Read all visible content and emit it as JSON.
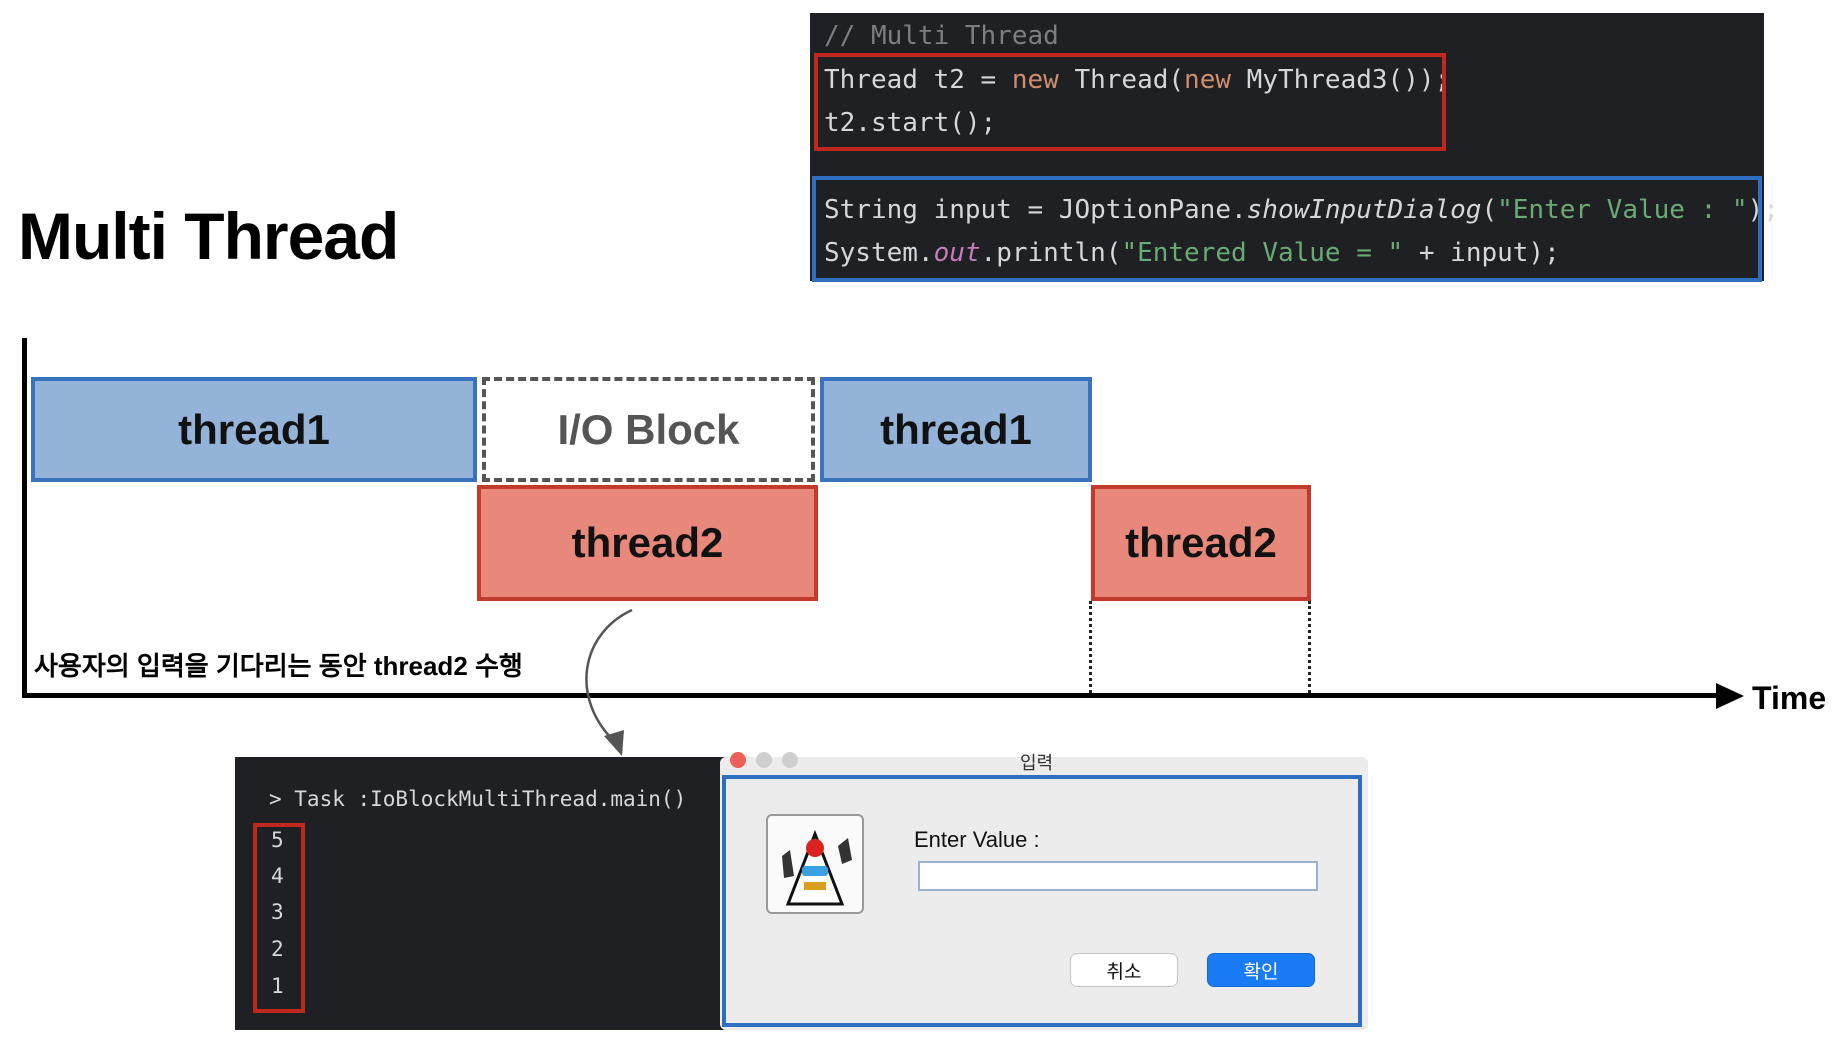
{
  "title": "Multi Thread",
  "code": {
    "comment": "// Multi Thread",
    "line1": {
      "a": "Thread t2 = ",
      "kw1": "new",
      "b": " Thread(",
      "kw2": "new",
      "c": " MyThread3());"
    },
    "line2": "t2.start();",
    "line3": {
      "a": "String input = JOptionPane.",
      "italic": "showInputDialog",
      "b": "(",
      "str": "\"Enter Value : \"",
      "c": ");"
    },
    "line4": {
      "a": "System.",
      "field": "out",
      "b": ".println(",
      "str": "\"Entered Value = \"",
      "c": " + input);"
    }
  },
  "timeline": {
    "blocks": {
      "thread1_a": "thread1",
      "io_block": "I/O Block",
      "thread1_b": "thread1",
      "thread2_a": "thread2",
      "thread2_b": "thread2"
    },
    "axis_label": "Time",
    "caption": "사용자의 입력을 기다리는 동안 thread2 수행"
  },
  "console": {
    "task_line": "> Task :IoBlockMultiThread.main()",
    "countdown": [
      "5",
      "4",
      "3",
      "2",
      "1"
    ]
  },
  "dialog": {
    "title": "입력",
    "icon_name": "java-duke-zulu-icon",
    "prompt": "Enter Value :",
    "input_value": "",
    "cancel_label": "취소",
    "ok_label": "확인"
  },
  "colors": {
    "thread1": "#93b3d8",
    "thread2": "#e8887a",
    "highlight_red": "#c0281e",
    "highlight_blue": "#2f6fc0"
  }
}
